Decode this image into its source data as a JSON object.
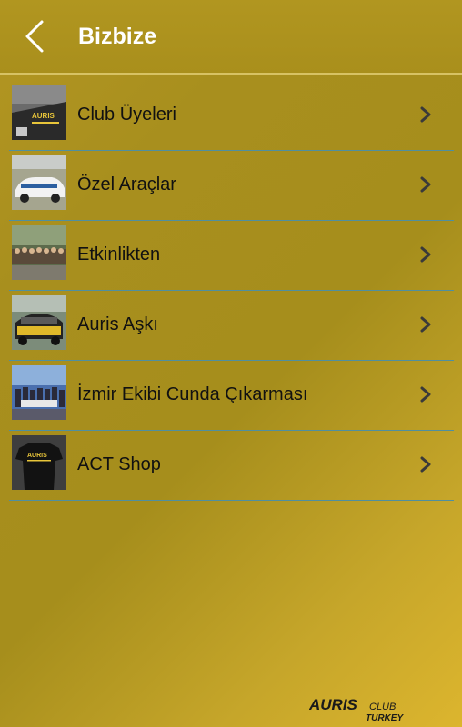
{
  "header": {
    "title": "Bizbize",
    "back_icon": "chevron-left-icon"
  },
  "list": [
    {
      "label": "Club Üyeleri",
      "thumb": "car-sticker-photo"
    },
    {
      "label": "Özel Araçlar",
      "thumb": "white-car-photo"
    },
    {
      "label": "Etkinlikten",
      "thumb": "group-event-photo"
    },
    {
      "label": "Auris Aşkı",
      "thumb": "yellow-car-photo"
    },
    {
      "label": "İzmir Ekibi Cunda Çıkarması",
      "thumb": "izmir-team-photo"
    },
    {
      "label": "ACT Shop",
      "thumb": "tshirt-photo"
    }
  ],
  "brand": {
    "name": "AURIS",
    "suffix": "CLUB",
    "country": "TURKEY"
  },
  "colors": {
    "accent": "#b39622",
    "divider": "#4f8fa0",
    "text": "#111111",
    "title": "#ffffff"
  }
}
